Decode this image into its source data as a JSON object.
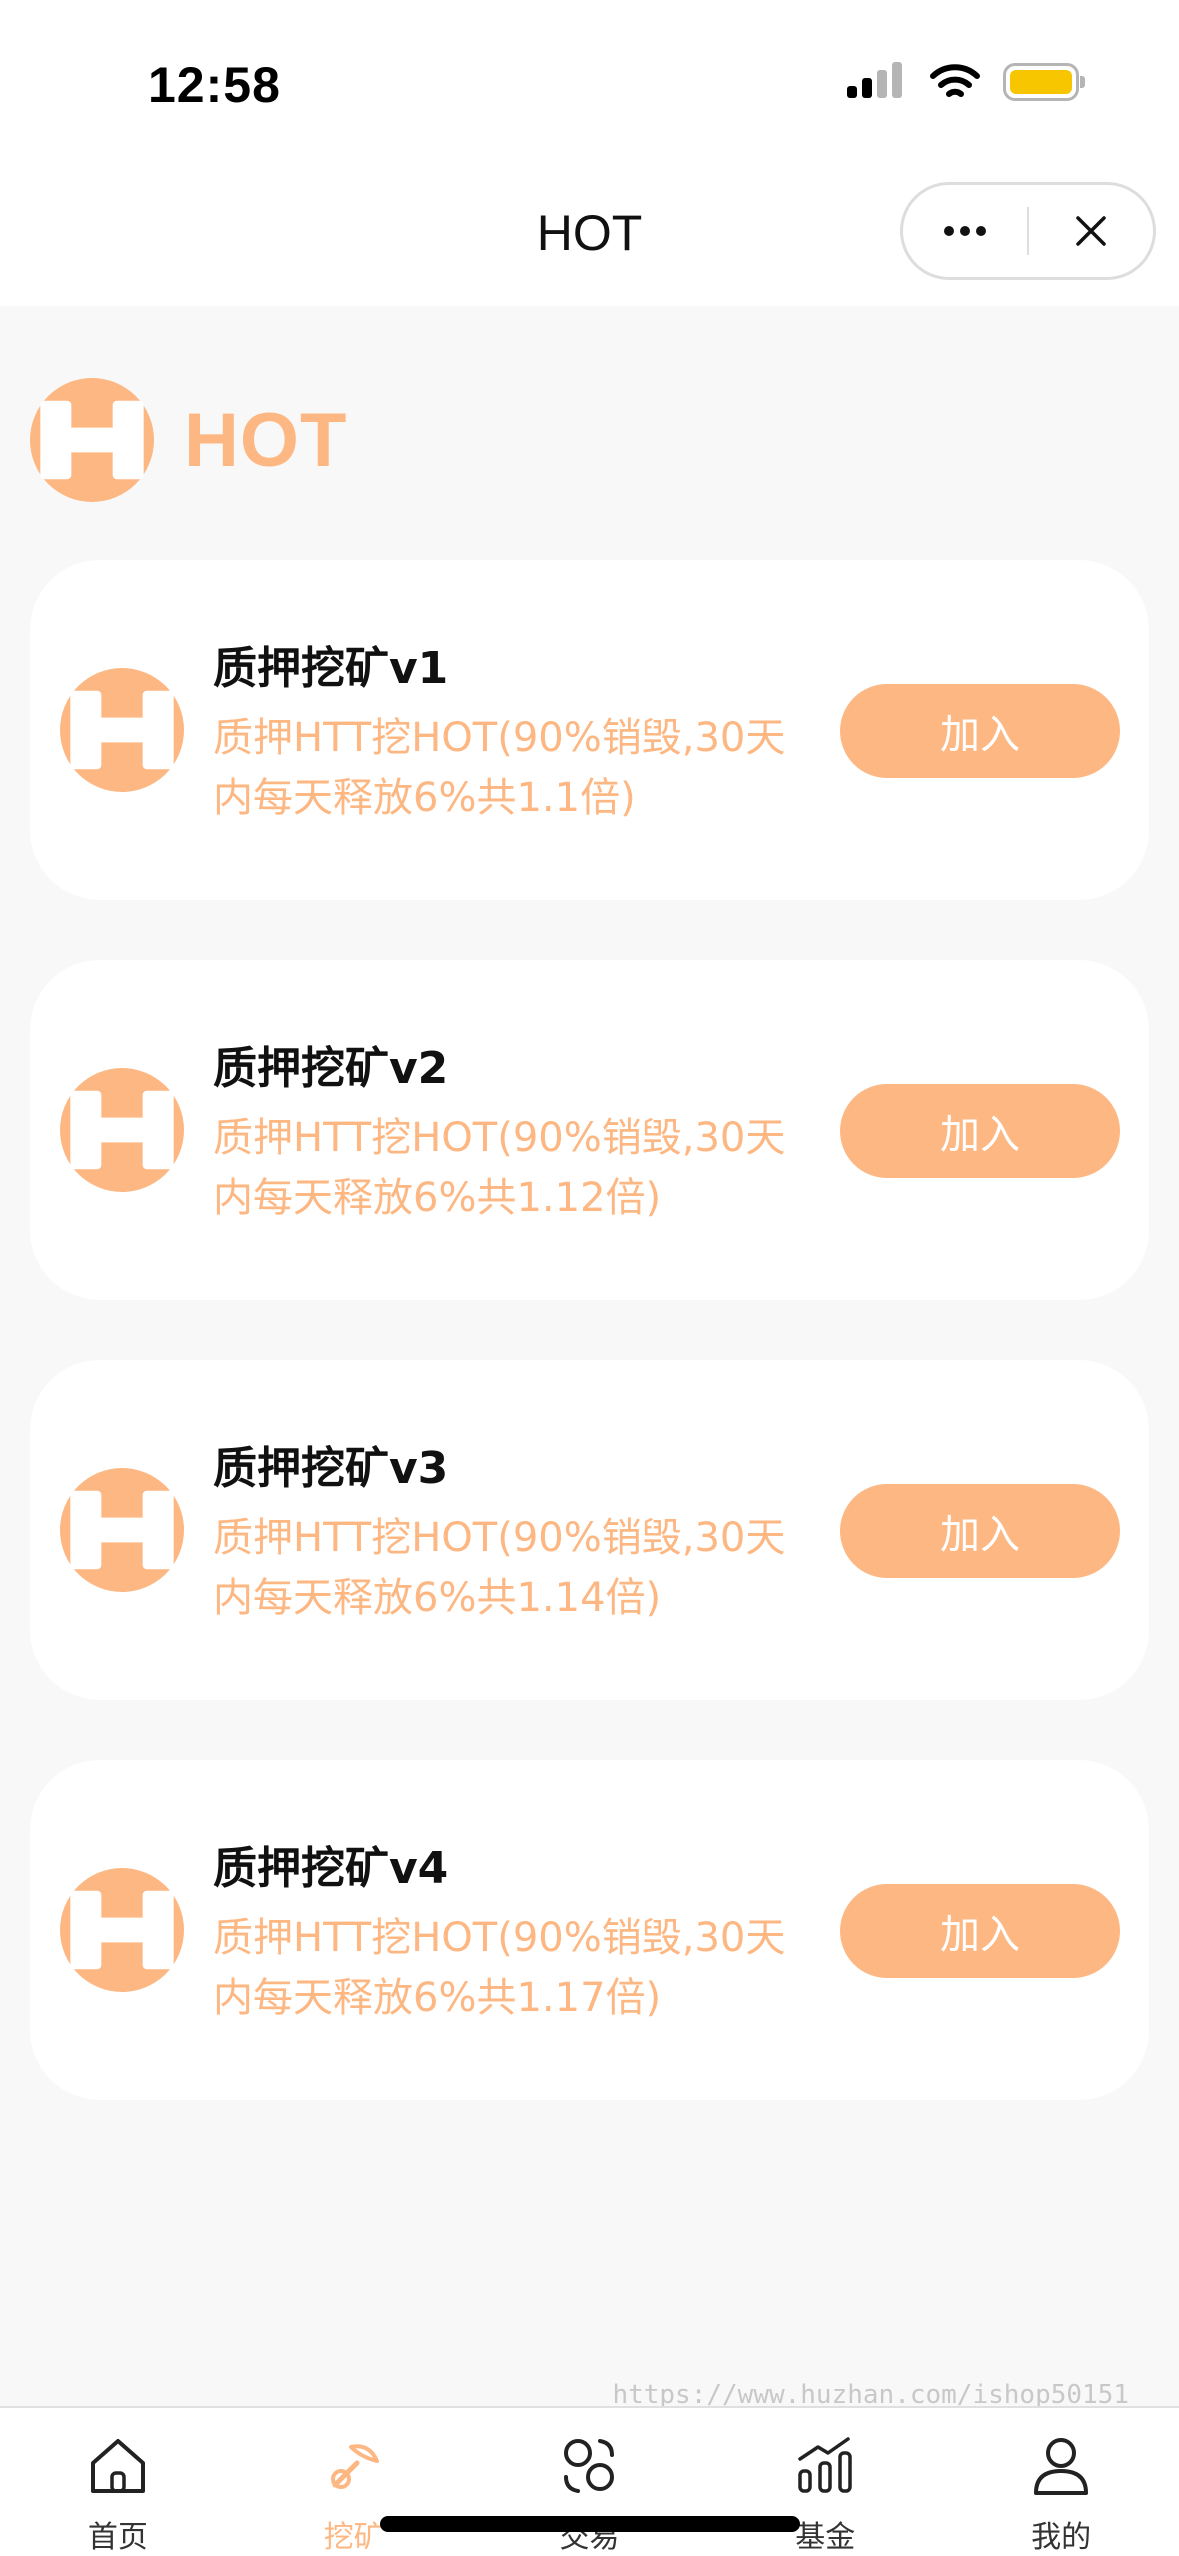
{
  "status_bar": {
    "time": "12:58"
  },
  "nav": {
    "title": "HOT"
  },
  "brand": {
    "name": "HOT"
  },
  "colors": {
    "accent": "#fdb782",
    "background": "#f8f8f8",
    "card": "#ffffff"
  },
  "plans": [
    {
      "title": "质押挖矿v1",
      "desc_line1": "质押HTT挖HOT(90%销毁,30天",
      "desc_line2": "内每天释放6%共1.1倍)",
      "button": "加入"
    },
    {
      "title": "质押挖矿v2",
      "desc_line1": "质押HTT挖HOT(90%销毁,30天",
      "desc_line2": "内每天释放6%共1.12倍)",
      "button": "加入"
    },
    {
      "title": "质押挖矿v3",
      "desc_line1": "质押HTT挖HOT(90%销毁,30天",
      "desc_line2": "内每天释放6%共1.14倍)",
      "button": "加入"
    },
    {
      "title": "质押挖矿v4",
      "desc_line1": "质押HTT挖HOT(90%销毁,30天",
      "desc_line2": "内每天释放6%共1.17倍)",
      "button": "加入"
    }
  ],
  "watermark": "https://www.huzhan.com/ishop50151",
  "tabs": [
    {
      "label": "首页",
      "icon": "home-icon"
    },
    {
      "label": "挖矿",
      "icon": "mining-icon",
      "active": true
    },
    {
      "label": "交易",
      "icon": "exchange-icon"
    },
    {
      "label": "基金",
      "icon": "fund-chart-icon"
    },
    {
      "label": "我的",
      "icon": "user-icon"
    }
  ]
}
